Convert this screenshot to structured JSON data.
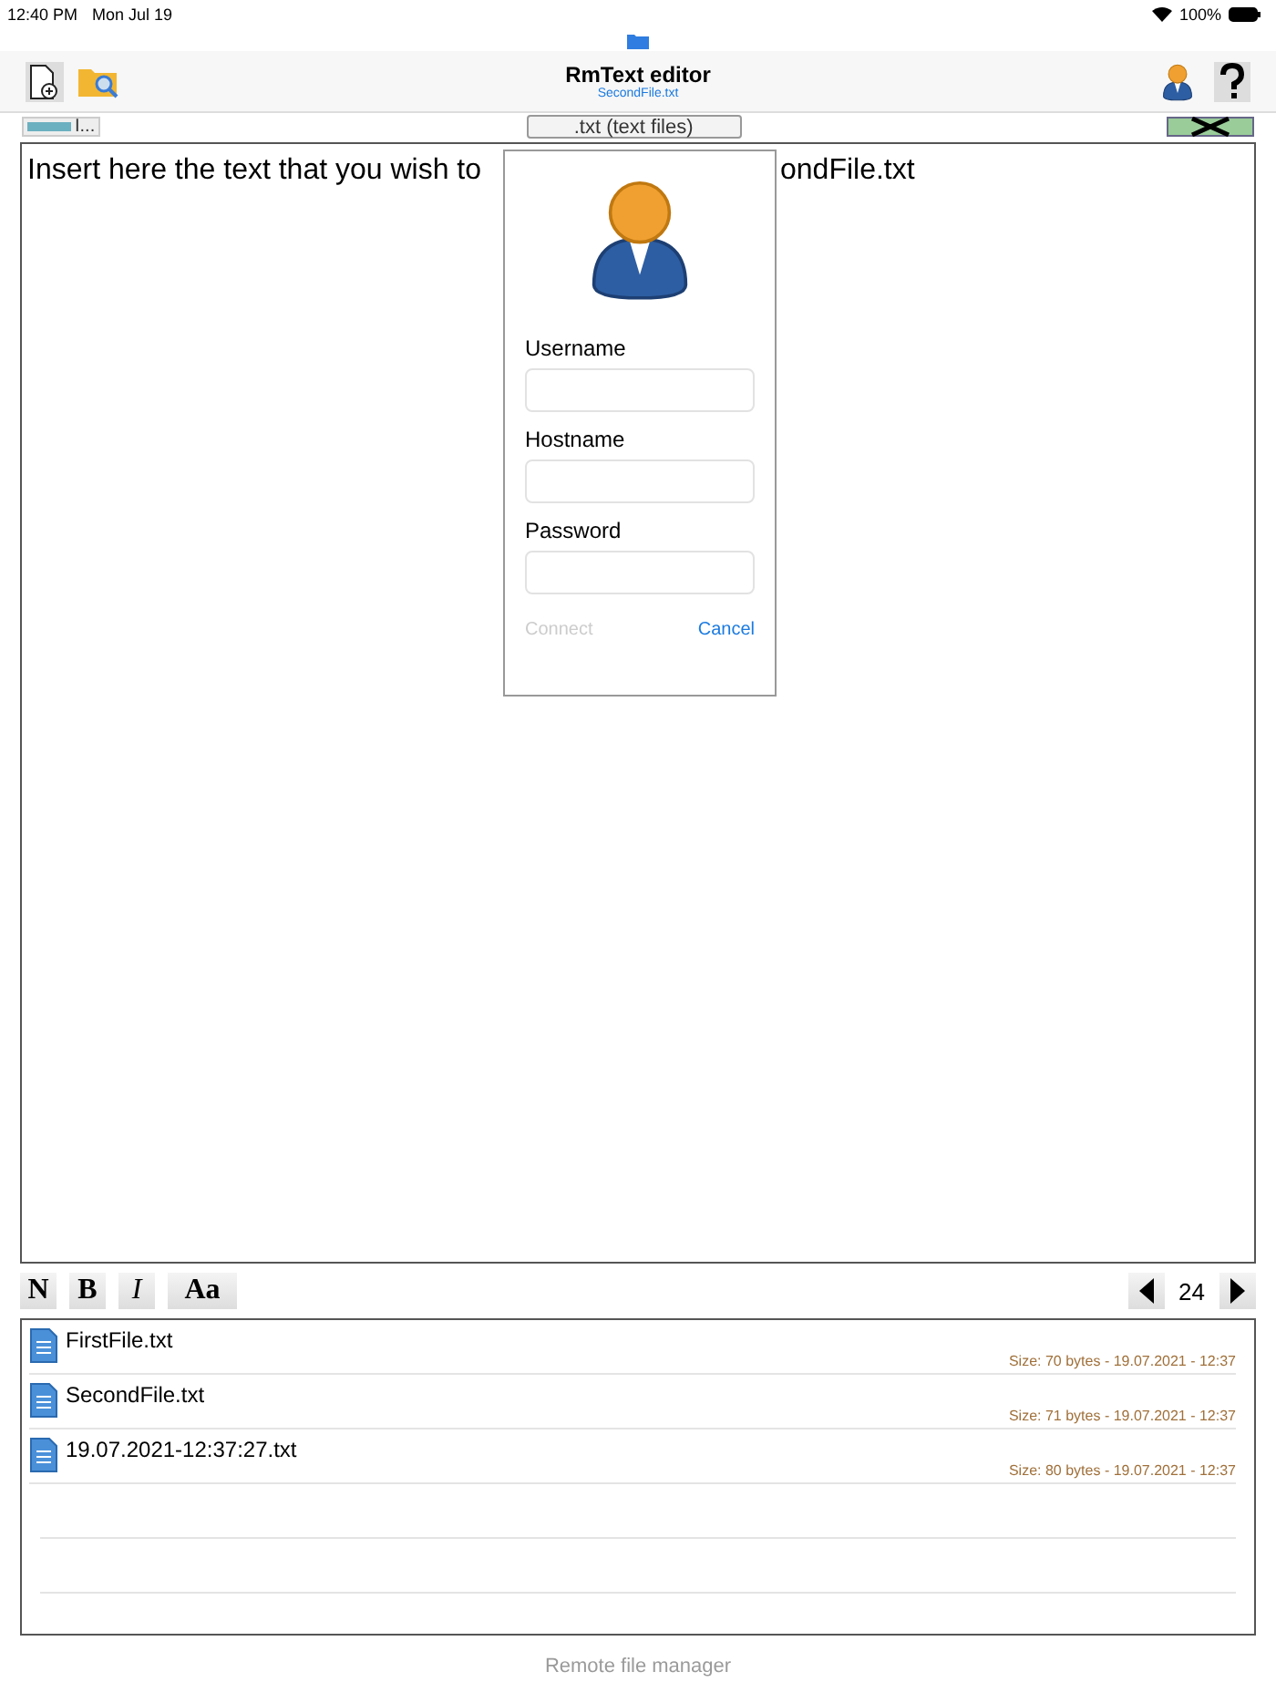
{
  "status_bar": {
    "time": "12:40 PM",
    "date": "Mon Jul 19",
    "battery": "100%"
  },
  "title_bar": {
    "title": "RmText editor",
    "subtitle": "SecondFile.txt"
  },
  "sub_bar": {
    "left_button": "I...",
    "filter": ".txt (text files)"
  },
  "editor": {
    "text_before": "Insert here the text that you wish to",
    "text_after": "ondFile.txt"
  },
  "login_popover": {
    "fields": [
      {
        "label": "Username"
      },
      {
        "label": "Hostname"
      },
      {
        "label": "Password"
      }
    ],
    "buttons": [
      {
        "label": "Connect",
        "disabled": true
      },
      {
        "label": "Cancel",
        "disabled": false
      }
    ]
  },
  "format_bar": {
    "buttons": [
      {
        "label": "N",
        "kind": "normal"
      },
      {
        "label": "B",
        "kind": "bold"
      },
      {
        "label": "I",
        "kind": "italic"
      },
      {
        "label": "Aa",
        "kind": "font"
      }
    ],
    "font_size": "24"
  },
  "files": [
    {
      "name": "FirstFile.txt",
      "info": "Size: 70 bytes - 19.07.2021 - 12:37"
    },
    {
      "name": "SecondFile.txt",
      "info": "Size: 71 bytes - 19.07.2021 - 12:37"
    },
    {
      "name": "19.07.2021-12:37:27.txt",
      "info": "Size: 80 bytes - 19.07.2021 - 12:37"
    }
  ],
  "footer": {
    "label": "Remote file manager",
    "disabled": true
  }
}
